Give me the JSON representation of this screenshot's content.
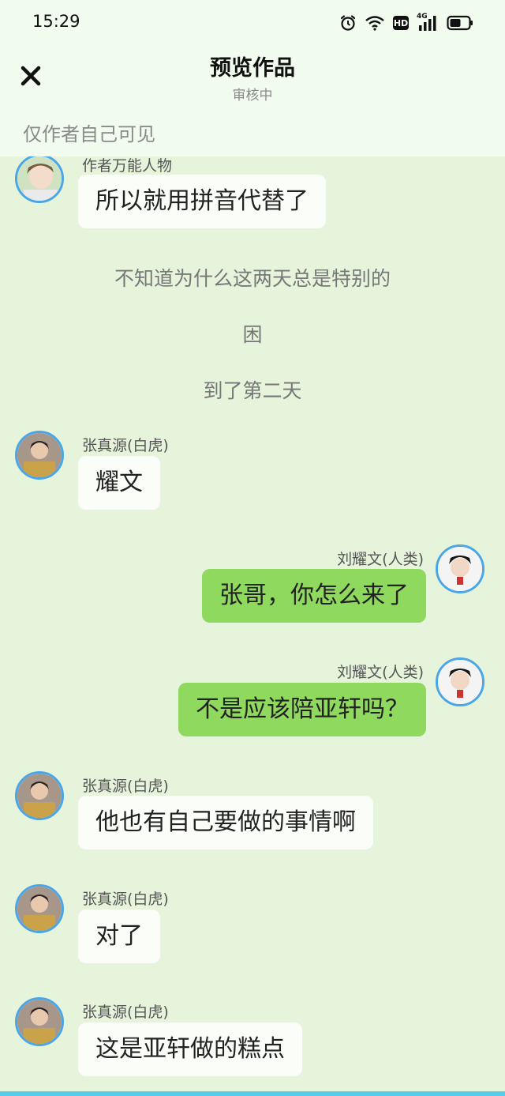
{
  "status_bar": {
    "time": "15:29",
    "icons": [
      "alarm-icon",
      "wifi-icon",
      "hd-icon",
      "signal-4g-icon",
      "battery-icon"
    ],
    "hd_label": "HD",
    "net_label": "4G"
  },
  "nav": {
    "close_icon": "close-icon",
    "title": "预览作品",
    "subtitle": "审核中",
    "visibility_note": "仅作者自己可见"
  },
  "colors": {
    "background": "#e6f4dc",
    "header": "#f1fbee",
    "bubble_left": "#fbfdf9",
    "bubble_right": "#8fd95e",
    "avatar_ring": "#4aa6e6",
    "bottom_strip": "#58cde8"
  },
  "messages": [
    {
      "kind": "bubble",
      "side": "left",
      "sender": "作者万能人物",
      "text": "所以就用拼音代替了"
    },
    {
      "kind": "narration",
      "text": "不知道为什么这两天总是特别的"
    },
    {
      "kind": "narration",
      "text": "困"
    },
    {
      "kind": "narration",
      "text": "到了第二天"
    },
    {
      "kind": "bubble",
      "side": "left",
      "sender": "张真源(白虎)",
      "text": "耀文"
    },
    {
      "kind": "bubble",
      "side": "right",
      "sender": "刘耀文(人类)",
      "text": "张哥，你怎么来了"
    },
    {
      "kind": "bubble",
      "side": "right",
      "sender": "刘耀文(人类)",
      "text": "不是应该陪亚轩吗？"
    },
    {
      "kind": "bubble",
      "side": "left",
      "sender": "张真源(白虎)",
      "text": "他也有自己要做的事情啊"
    },
    {
      "kind": "bubble",
      "side": "left",
      "sender": "张真源(白虎)",
      "text": "对了"
    },
    {
      "kind": "bubble",
      "side": "left",
      "sender": "张真源(白虎)",
      "text": "这是亚轩做的糕点"
    }
  ]
}
